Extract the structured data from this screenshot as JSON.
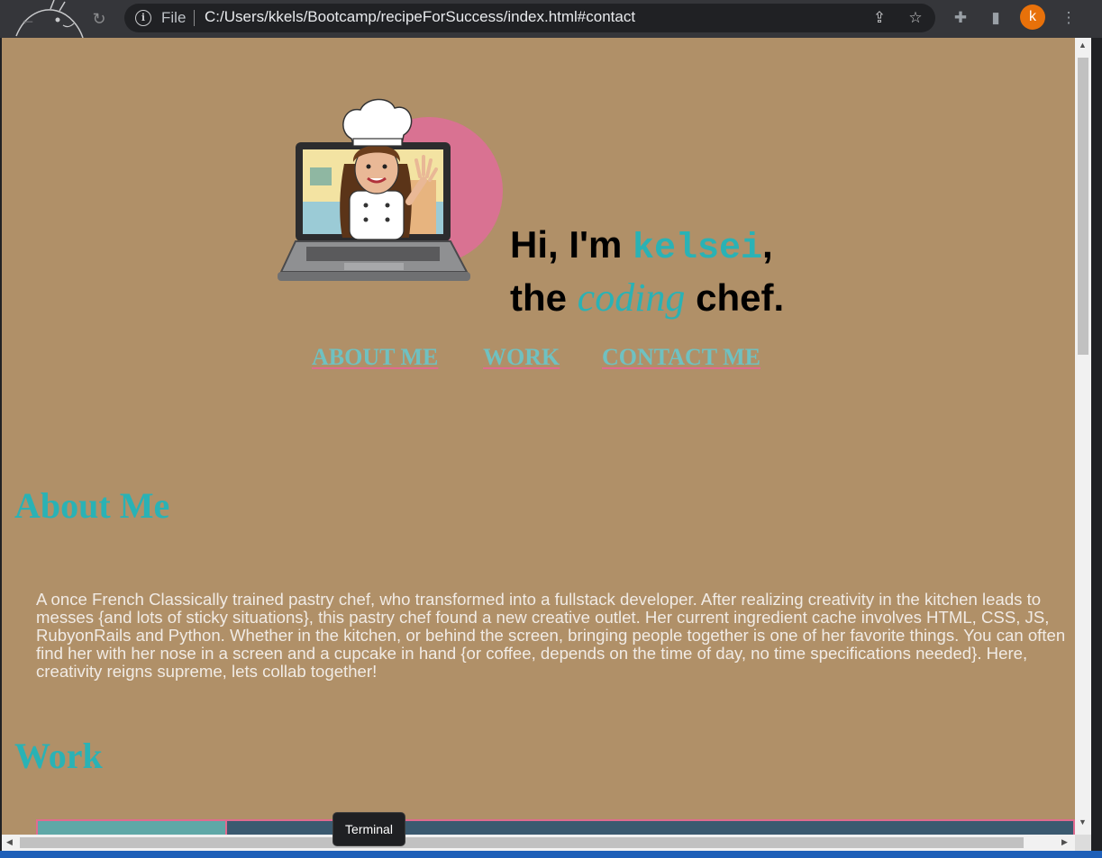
{
  "browser": {
    "address": {
      "scheme_label": "File",
      "url": "C:/Users/kkels/Bootcamp/recipeForSuccess/index.html#contact"
    },
    "profile_initial": "k",
    "icons": [
      "back-icon",
      "reload-icon",
      "info-icon",
      "share-icon",
      "star-icon",
      "extensions-icon",
      "sidepanel-icon",
      "menu-icon"
    ]
  },
  "page": {
    "hero": {
      "line1_prefix": "Hi, I'm ",
      "name": "kelsei",
      "line1_suffix": ",",
      "line2_prefix": "the ",
      "coding": "coding",
      "line2_suffix": " chef."
    },
    "nav": [
      "ABOUT ME",
      "WORK",
      "CONTACT ME"
    ],
    "about": {
      "heading": "About Me",
      "text": "A once French Classically trained pastry chef, who transformed into a fullstack developer. After realizing creativity in the kitchen leads to messes {and lots of sticky situations}, this pastry chef found a new creative outlet. Her current ingredient cache involves HTML, CSS, JS, RubyonRails and Python. Whether in the kitchen, or behind the screen, bringing people together is one of her favorite things. You can often find her with her nose in a screen and a cupcake in hand {or coffee, depends on the time of day, no time specifications needed}. Here, creativity reigns supreme, lets collab together!"
    },
    "work": {
      "heading": "Work"
    }
  },
  "tooltip": "Terminal",
  "colors": {
    "page_background": "#b09068",
    "accent_teal": "#2ab2b5",
    "accent_pink": "#e06b8f",
    "nav_link": "#6fc1c1"
  }
}
